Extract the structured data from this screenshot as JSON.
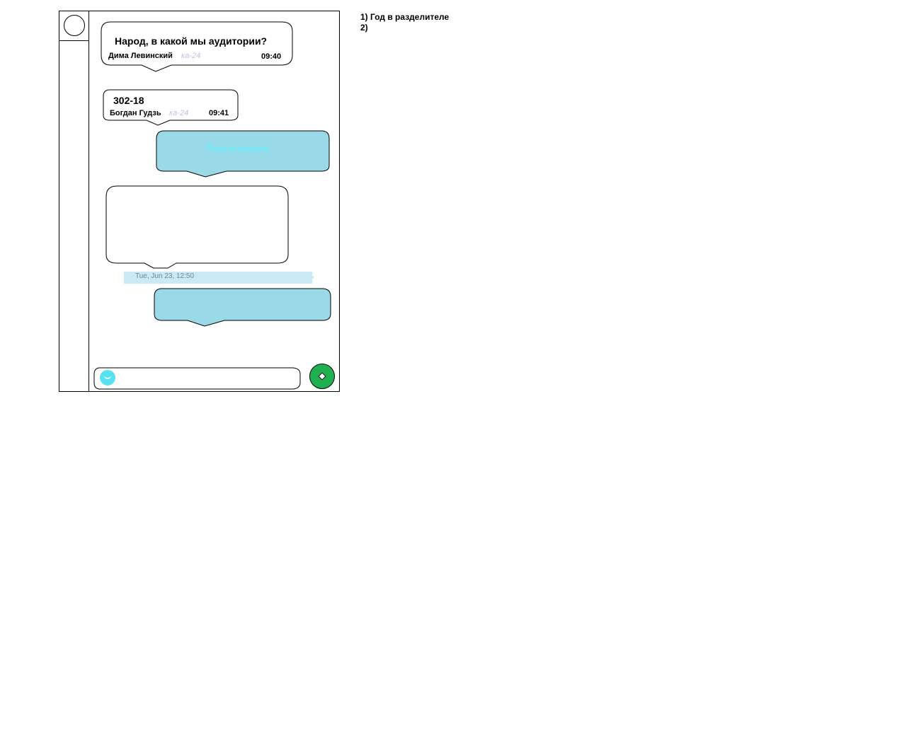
{
  "messages": [
    {
      "text": "Народ, в какой мы аудитории?",
      "author": "Дима Левинский",
      "group": "ка-24",
      "time": "09:40"
    },
    {
      "text": "302-18",
      "author": "Богдан Гудзь",
      "group": "ка-24",
      "time": "09:41"
    },
    {
      "text": "Пользователь"
    }
  ],
  "date_separator": "Tue, Jun 23, 12:50",
  "notes": [
    "1) Год в разделителе",
    "2)"
  ],
  "colors": {
    "own_bubble": "#9ad9e8",
    "send_button": "#1fb150",
    "emoji": "#55e3f0",
    "group_text": "#c0bfe0",
    "own_text": "#66f0ff"
  },
  "icons": {
    "send": "send-icon",
    "emoji": "emoji-icon",
    "avatar": "avatar-circle"
  }
}
